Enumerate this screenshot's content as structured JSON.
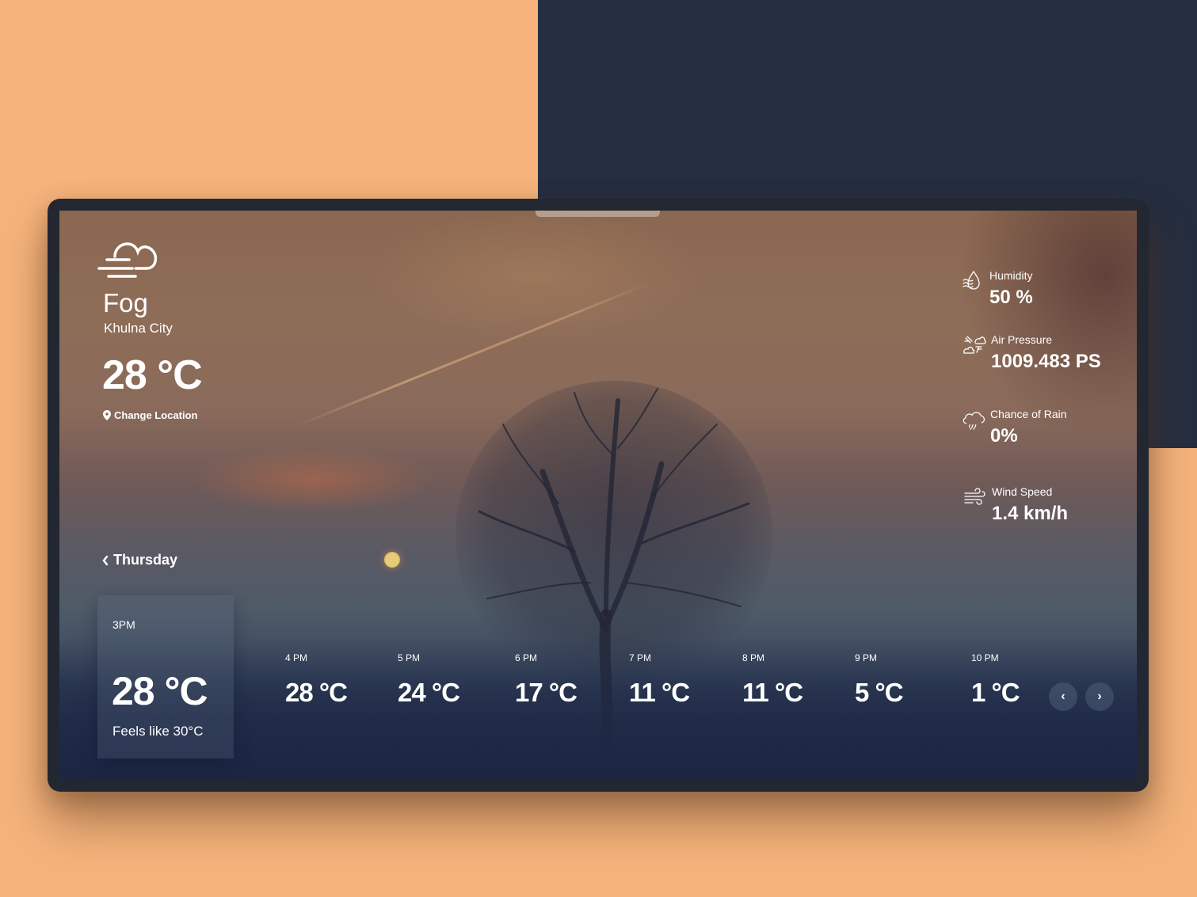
{
  "colors": {
    "background_peach": "#f6b47c",
    "background_navy": "#252e40",
    "device_frame": "#222731",
    "text": "#ffffff"
  },
  "current": {
    "condition_icon": "fog-cloud-icon",
    "condition": "Fog",
    "city": "Khulna City",
    "temperature": "28 °C",
    "change_location_icon": "map-pin-icon",
    "change_location_label": "Change Location"
  },
  "day_nav": {
    "icon": "chevron-left-icon",
    "label": "Thursday"
  },
  "current_hour": {
    "time": "3PM",
    "temperature": "28 °C",
    "feels_like": "Feels like 30°C"
  },
  "hourly": [
    {
      "time": "4 PM",
      "temperature": "28 °C"
    },
    {
      "time": "5 PM",
      "temperature": "24 °C"
    },
    {
      "time": "6 PM",
      "temperature": "17 °C"
    },
    {
      "time": "7 PM",
      "temperature": "11 °C"
    },
    {
      "time": "8 PM",
      "temperature": "11 °C"
    },
    {
      "time": "9 PM",
      "temperature": "5 °C"
    },
    {
      "time": "10 PM",
      "temperature": "1 °C"
    }
  ],
  "hourly_nav": {
    "prev_icon": "chevron-left-icon",
    "prev_glyph": "‹",
    "next_icon": "chevron-right-icon",
    "next_glyph": "›"
  },
  "stats": [
    {
      "icon": "humidity-drop-icon",
      "label": "Humidity",
      "value": "50 %"
    },
    {
      "icon": "air-pressure-icon",
      "label": "Air Pressure",
      "value": "1009.483 PS"
    },
    {
      "icon": "rain-cloud-icon",
      "label": "Chance of Rain",
      "value": "0%"
    },
    {
      "icon": "wind-icon",
      "label": "Wind Speed",
      "value": "1.4 km/h"
    }
  ]
}
